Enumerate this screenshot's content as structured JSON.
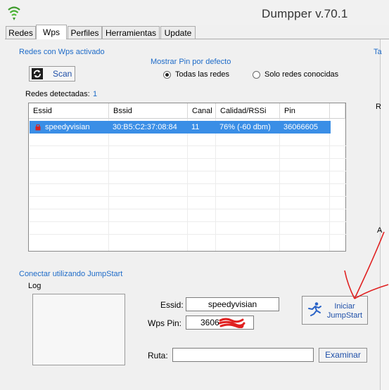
{
  "window": {
    "title": "Dumpper v.70.1"
  },
  "tabs": [
    {
      "label": "Redes"
    },
    {
      "label": "Wps"
    },
    {
      "label": "Perfiles"
    },
    {
      "label": "Herramientas"
    },
    {
      "label": "Update"
    }
  ],
  "wps": {
    "section_title": "Redes con Wps activado",
    "scan_label": "Scan",
    "pin_group_title": "Mostrar Pin por defecto",
    "radio_all": "Todas las redes",
    "radio_known": "Solo redes conocidas",
    "selected_radio": "Todas las redes",
    "detected_label": "Redes detectadas:",
    "detected_count": "1",
    "table": {
      "headers": [
        "Essid",
        "Bssid",
        "Canal",
        "Calidad/RSSi",
        "Pin"
      ],
      "rows": [
        {
          "essid": "speedyvisian",
          "bssid": "30:B5:C2:37:08:84",
          "canal": "11",
          "calidad": "76% (-60 dbm)",
          "pin": "36066605"
        }
      ]
    }
  },
  "jumpstart": {
    "section_title": "Conectar utilizando JumpStart",
    "log_label": "Log",
    "essid_label": "Essid:",
    "essid_value": "speedyvisian",
    "pin_label": "Wps Pin:",
    "pin_value": "3606",
    "start_label_line1": "Iniciar",
    "start_label_line2": "JumpStart",
    "ruta_label": "Ruta:",
    "ruta_value": "",
    "browse_label": "Examinar"
  },
  "side_fragments": {
    "top": "Ta",
    "mid": "R",
    "low": "A"
  },
  "colors": {
    "accent_text": "#1e6bc8",
    "selection": "#3a8ee6",
    "annotation": "#e02020"
  }
}
